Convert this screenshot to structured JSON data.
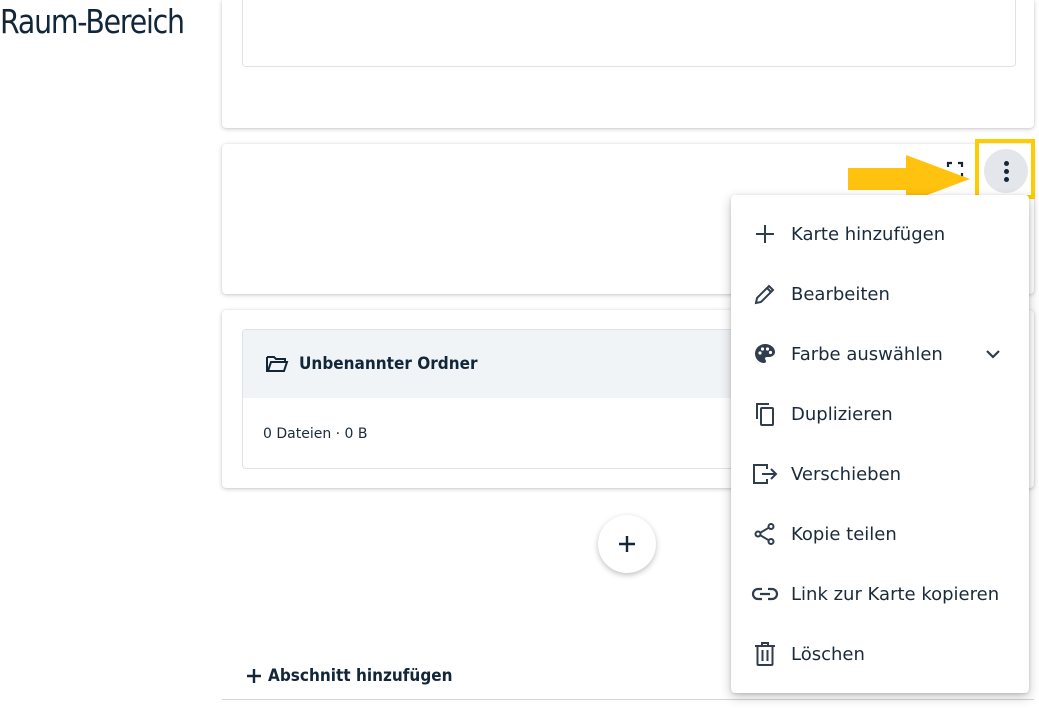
{
  "header": {
    "title": "Raum-Bereich",
    "menu_icon": "dots-vertical-icon"
  },
  "card_actions": {
    "focus_icon": "fullscreen-icon",
    "menu_icon": "dots-vertical-icon"
  },
  "folder": {
    "icon": "folder-open-icon",
    "title": "Unbenannter Ordner",
    "meta": "0 Dateien · 0 B"
  },
  "add_card": {
    "icon": "plus-icon"
  },
  "add_section": {
    "icon": "plus-icon",
    "label": "Abschnitt hinzufügen"
  },
  "annotation": {
    "highlight_color": "#ffcc00"
  },
  "context_menu": {
    "items": [
      {
        "icon": "plus-icon",
        "label": "Karte hinzufügen"
      },
      {
        "icon": "pencil-icon",
        "label": "Bearbeiten"
      },
      {
        "icon": "palette-icon",
        "label": "Farbe auswählen",
        "trailing_icon": "chevron-down-icon"
      },
      {
        "icon": "copy-icon",
        "label": "Duplizieren"
      },
      {
        "icon": "move-icon",
        "label": "Verschieben"
      },
      {
        "icon": "share-icon",
        "label": "Kopie teilen"
      },
      {
        "icon": "link-icon",
        "label": "Link zur Karte kopieren"
      },
      {
        "icon": "trash-icon",
        "label": "Löschen"
      }
    ]
  }
}
